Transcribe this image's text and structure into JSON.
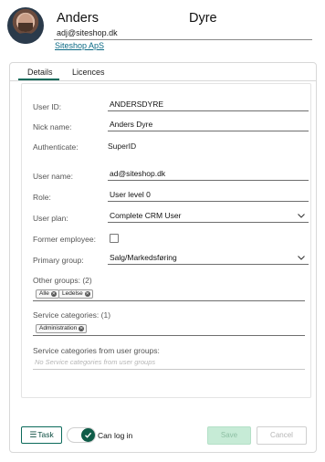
{
  "header": {
    "first_name": "Anders",
    "last_name": "Dyre",
    "email": "adj@siteshop.dk",
    "company": "Siteshop ApS"
  },
  "tabs": [
    {
      "label": "Details",
      "active": true
    },
    {
      "label": "Licences",
      "active": false
    }
  ],
  "form": {
    "user_id": {
      "label": "User ID:",
      "value": "ANDERSDYRE"
    },
    "nick_name": {
      "label": "Nick name:",
      "value": "Anders Dyre"
    },
    "authenticate": {
      "label": "Authenticate:",
      "value": "SuperID"
    },
    "user_name": {
      "label": "User name:",
      "value": "ad@siteshop.dk"
    },
    "role": {
      "label": "Role:",
      "value": "User level 0"
    },
    "user_plan": {
      "label": "User plan:",
      "value": "Complete CRM User"
    },
    "former_employee": {
      "label": "Former employee:",
      "checked": false
    },
    "primary_group": {
      "label": "Primary group:",
      "value": "Salg/Markedsføring"
    },
    "other_groups": {
      "label": "Other groups: (2)",
      "tags": [
        "Alle",
        "Ledelse"
      ]
    },
    "service_categories": {
      "label": "Service categories: (1)",
      "tags": [
        "Administration"
      ]
    },
    "service_categories_from_groups": {
      "label": "Service categories from user groups:",
      "placeholder": "No Service categories from user groups"
    }
  },
  "footer": {
    "task_label": "Task",
    "can_log_in_label": "Can log in",
    "can_log_in": true,
    "save_label": "Save",
    "cancel_label": "Cancel"
  },
  "colors": {
    "accent": "#0b6a5a",
    "link": "#0b6a85",
    "save_disabled_bg": "#c6ebd6"
  }
}
